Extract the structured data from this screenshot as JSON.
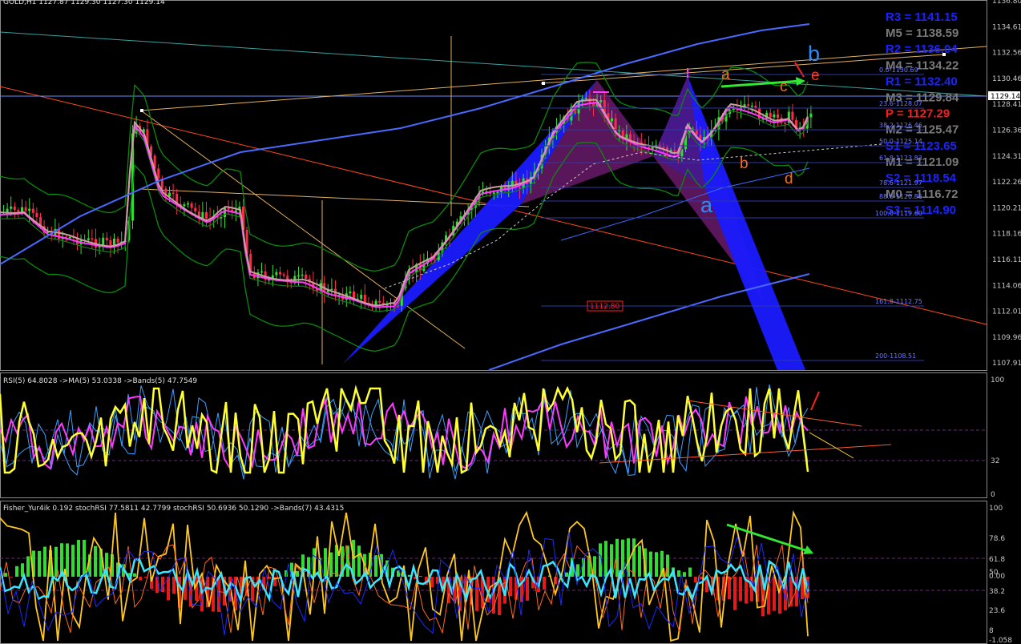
{
  "symbol_header": "GOLD,H1 1127.87 1129.30 1127.30 1129.14",
  "price_axis": [
    "1136.80",
    "1134.61",
    "1132.56",
    "1130.46",
    "1128.41",
    "1126.36",
    "1124.31",
    "1122.26",
    "1120.21",
    "1118.16",
    "1116.11",
    "1114.06",
    "1112.01",
    "1109.96",
    "1107.91"
  ],
  "current_price": "1129.14",
  "pivot_levels": [
    {
      "label": "R3 = 1141.15",
      "color": "#1a22ff"
    },
    {
      "label": "M5 = 1138.59",
      "color": "#7a7a7a"
    },
    {
      "label": "R2 = 1136.04",
      "color": "#1a22ff"
    },
    {
      "label": "M4 = 1134.22",
      "color": "#7a7a7a"
    },
    {
      "label": "R1 = 1132.40",
      "color": "#1a22ff"
    },
    {
      "label": "M3 = 1129.84",
      "color": "#7a7a7a"
    },
    {
      "label": "P = 1127.29",
      "color": "#ff1a1a"
    },
    {
      "label": "M2 = 1125.47",
      "color": "#7a7a7a"
    },
    {
      "label": "S1 = 1123.65",
      "color": "#1a22ff"
    },
    {
      "label": "M1 = 1121.09",
      "color": "#7a7a7a"
    },
    {
      "label": "S2 = 1118.54",
      "color": "#1a22ff"
    },
    {
      "label": "M0 = 1116.72",
      "color": "#7a7a7a"
    },
    {
      "label": "S3 = 1114.90",
      "color": "#1a22ff"
    }
  ],
  "fib_levels": [
    "0.0-1130.69",
    "23.6-1128.07",
    "38.2-1126.46",
    "50.0-1125.14",
    "61.8-1123.83",
    "78.6-1121.97",
    "88.6-1120.86",
    "100.0-1119.60",
    "161.8-1112.75",
    "200-1108.51"
  ],
  "price_box": "1112.80",
  "wave_labels": [
    {
      "text": "a",
      "color": "#ff6a1a"
    },
    {
      "text": "b",
      "color": "#ff6a1a"
    },
    {
      "text": "c",
      "color": "#ff6a1a"
    },
    {
      "text": "d",
      "color": "#ff6a1a"
    },
    {
      "text": "e",
      "color": "#ff3a1a"
    },
    {
      "text": "b",
      "color": "#2a8cff"
    },
    {
      "text": "a",
      "color": "#2a8cff"
    }
  ],
  "rsi_panel": {
    "header": "RSI(5) 64.8028 ->MA(5) 53.0338 ->Bands(5) 47.7549",
    "axis": [
      "100",
      "32",
      "0"
    ]
  },
  "fisher_panel": {
    "header": "Fisher_Yur4ik 0.192 stochRSI 77.5811 42.7799 stochRSI 50.6936 50.1290 ->Bands(7) 43.4315",
    "axis": [
      "100",
      "78.6",
      "61.8",
      "50",
      "0.00",
      "38.2",
      "23.6",
      "8",
      "-1.058"
    ]
  },
  "colors": {
    "up": "#32dc32",
    "down": "#ff2a4a",
    "bb": "#0a8a0a",
    "ma": "#4a6aff",
    "rsi": "#ffff33",
    "stoch": "#ffc81e"
  }
}
